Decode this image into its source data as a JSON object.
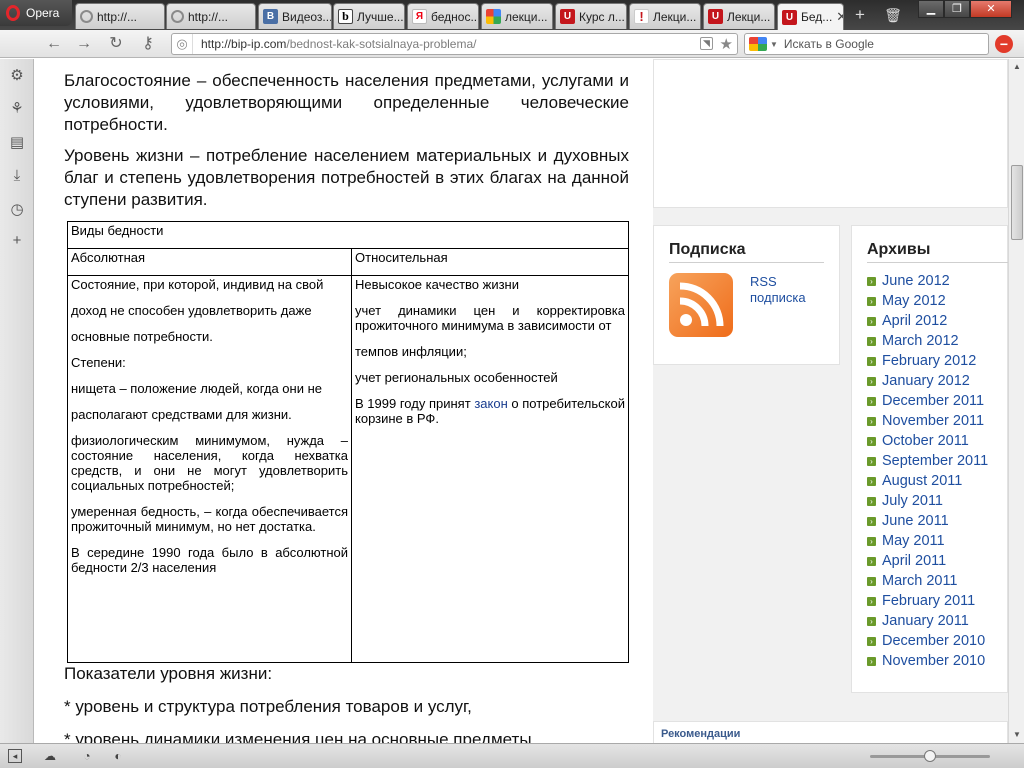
{
  "browser": {
    "menu_label": "Opera",
    "tabs": [
      {
        "label": "http://...",
        "icon": "loading-icon"
      },
      {
        "label": "http://...",
        "icon": "loading-icon"
      },
      {
        "label": "Видеоз...",
        "icon": "vk-icon",
        "icon_text": "В"
      },
      {
        "label": "Лучше...",
        "icon": "b-icon",
        "icon_text": "b"
      },
      {
        "label": "беднос...",
        "icon": "yandex-icon",
        "icon_text": "Я"
      },
      {
        "label": "лекци...",
        "icon": "google-icon"
      },
      {
        "label": "Курс л...",
        "icon": "u-icon"
      },
      {
        "label": "Лекци...",
        "icon": "exclaim-icon",
        "icon_text": "!"
      },
      {
        "label": "Лекци...",
        "icon": "u-icon"
      },
      {
        "label": "Бед...",
        "icon": "u-icon",
        "active": true
      }
    ],
    "new_tab": "+",
    "trash": "🗑",
    "address": {
      "host": "http://bip-ip.com",
      "path": "/bednost-kak-sotsialnaya-problema/"
    },
    "search_placeholder": "Искать в Google"
  },
  "article": {
    "paragraphs": [
      "Благосостояние – обеспеченность населения предметами, услугами и условиями, удовлетворяющими определенные человеческие потребности.",
      "Уровень жизни – потребление населением материальных и духовных благ и степень удовлетворения потребностей в этих благах на данной ступени развития."
    ],
    "table": {
      "title": "Виды бедности",
      "col_absolute": "Абсолютная",
      "col_relative": "Относительная",
      "absolute_items": [
        "Состояние, при которой, индивид на свой",
        "доход не способен удовлетворить даже",
        "основные потребности.",
        "Степени:",
        "нищета – положение людей, когда они не",
        "располагают средствами для жизни.",
        "физиологическим минимумом, нужда – состояние населения, когда нехватка средств, и они не могут удовлетворить социальных потребностей;",
        "умеренная бедность, – когда обеспечивается прожиточный минимум, но нет достатка.",
        "В середине 1990 года было в абсолютной бедности 2/3 населения"
      ],
      "relative_items": [
        "Невысокое качество жизни",
        "учет динамики цен и корректировка прожиточного минимума в зависимости от",
        "темпов инфляции;",
        "учет региональных особенностей"
      ],
      "relative_last_before": "В 1999 году принят ",
      "relative_last_link": "закон",
      "relative_last_after": " о потребительской корзине в РФ."
    },
    "indicators_title": "Показатели уровня жизни:",
    "indicators": [
      "* уровень и структура потребления товаров и услуг,",
      "* уровень динамики изменения цен на основные предметы"
    ]
  },
  "sidebar": {
    "subscribe_title": "Подписка",
    "rss_label_1": "RSS",
    "rss_label_2": "подписка",
    "archives_title": "Архивы",
    "archives": [
      "June 2012",
      "May 2012",
      "April 2012",
      "March 2012",
      "February 2012",
      "January 2012",
      "December 2011",
      "November 2011",
      "October 2011",
      "September 2011",
      "August 2011",
      "July 2011",
      "June 2011",
      "May 2011",
      "April 2011",
      "March 2011",
      "February 2011",
      "January 2011",
      "December 2010",
      "November 2010"
    ],
    "recommendations_title": "Рекомендации"
  },
  "colors": {
    "accent_link": "#1f4fa0",
    "archive_bullet": "#6a9a2a",
    "rss_orange": "#ef6c1a"
  }
}
